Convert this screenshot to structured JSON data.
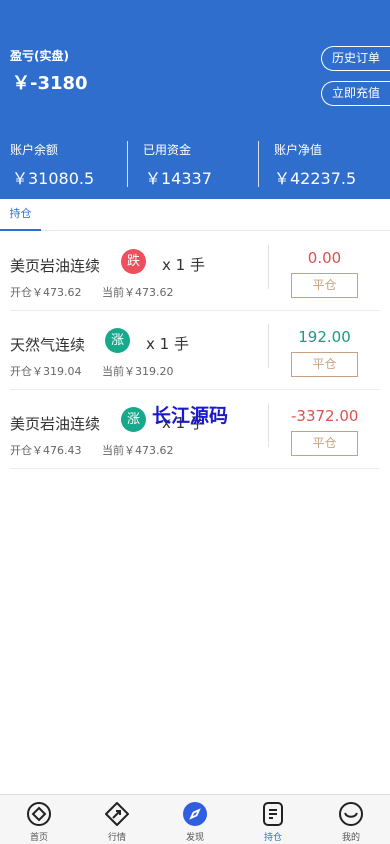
{
  "header": {
    "pl_label": "盈亏(实盘)",
    "pl_value": "￥-3180",
    "history_button": "历史订单",
    "charge_button": "立即充值",
    "stats": [
      {
        "label": "账户余额",
        "value": "￥31080.5"
      },
      {
        "label": "已用资金",
        "value": "￥14337"
      },
      {
        "label": "账户净值",
        "value": "￥42237.5"
      }
    ]
  },
  "tabs": {
    "active": "持仓"
  },
  "positions": [
    {
      "name": "美页岩油连续",
      "direction": "跌",
      "direction_type": "down",
      "qty": "x 1 手",
      "open": "开仓￥473.62",
      "current": "当前￥473.62",
      "pnl": "0.00",
      "pnl_color": "red",
      "close_label": "平仓"
    },
    {
      "name": "天然气连续",
      "direction": "涨",
      "direction_type": "up",
      "qty": "x 1 手",
      "open": "开仓￥319.04",
      "current": "当前￥319.20",
      "pnl": "192.00",
      "pnl_color": "green",
      "close_label": "平仓"
    },
    {
      "name": "美页岩油连续",
      "direction": "涨",
      "direction_type": "up",
      "qty": "x 1 手",
      "open": "开仓￥476.43",
      "current": "当前￥473.62",
      "pnl": "-3372.00",
      "pnl_color": "red",
      "close_label": "平仓"
    }
  ],
  "watermark": "长江源码",
  "bottom_nav": [
    {
      "label": "首页",
      "icon": "home-diamond-icon"
    },
    {
      "label": "行情",
      "icon": "market-arrow-icon"
    },
    {
      "label": "发现",
      "icon": "compass-icon"
    },
    {
      "label": "持仓",
      "icon": "holdings-doc-icon"
    },
    {
      "label": "我的",
      "icon": "profile-face-icon"
    }
  ],
  "colors": {
    "brand": "#2f6ecc",
    "down": "#ee4f5c",
    "up": "#18a88c",
    "close_border": "#c9a284"
  }
}
